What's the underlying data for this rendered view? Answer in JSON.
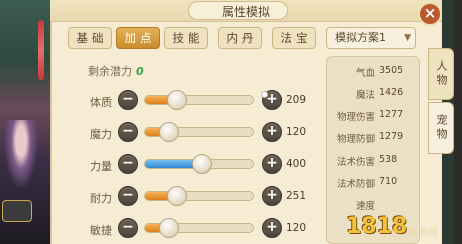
{
  "window": {
    "title": "属性模拟",
    "close_label": "×"
  },
  "tabs": [
    {
      "label": "基础",
      "active": false
    },
    {
      "label": "加点",
      "active": true
    },
    {
      "label": "技能",
      "active": false
    },
    {
      "label": "内丹",
      "active": false
    },
    {
      "label": "法宝",
      "active": false
    }
  ],
  "scheme": {
    "label": "模拟方案1",
    "arrow": "▼"
  },
  "remaining": {
    "label": "剩余潜力",
    "value": "0"
  },
  "attributes": [
    {
      "name": "体质",
      "value": "209",
      "level": 0.3,
      "color": "orange"
    },
    {
      "name": "魔力",
      "value": "120",
      "level": 0.22,
      "color": "orange"
    },
    {
      "name": "力量",
      "value": "400",
      "level": 0.53,
      "color": "blue"
    },
    {
      "name": "耐力",
      "value": "251",
      "level": 0.3,
      "color": "orange"
    },
    {
      "name": "敏捷",
      "value": "120",
      "level": 0.22,
      "color": "orange"
    }
  ],
  "controls": {
    "minus": "−",
    "plus": "+"
  },
  "stats": [
    {
      "label": "气血",
      "value": "3505"
    },
    {
      "label": "魔法",
      "value": "1426"
    },
    {
      "label": "物理伤害",
      "value": "1277"
    },
    {
      "label": "物理防御",
      "value": "1279"
    },
    {
      "label": "法术伤害",
      "value": "538"
    },
    {
      "label": "法术防御",
      "value": "710"
    },
    {
      "label": "速度",
      "value": ""
    }
  ],
  "side_tabs": [
    {
      "label": "人物",
      "active": false
    },
    {
      "label": "宠物",
      "active": true
    }
  ],
  "watermark": {
    "number": "1818",
    "text": "手游网"
  },
  "colors": {
    "accent": "#d9992f",
    "bar_orange": "#e07f1d",
    "bar_blue": "#2f86d0",
    "panel_bg": "#f5ecd3"
  }
}
